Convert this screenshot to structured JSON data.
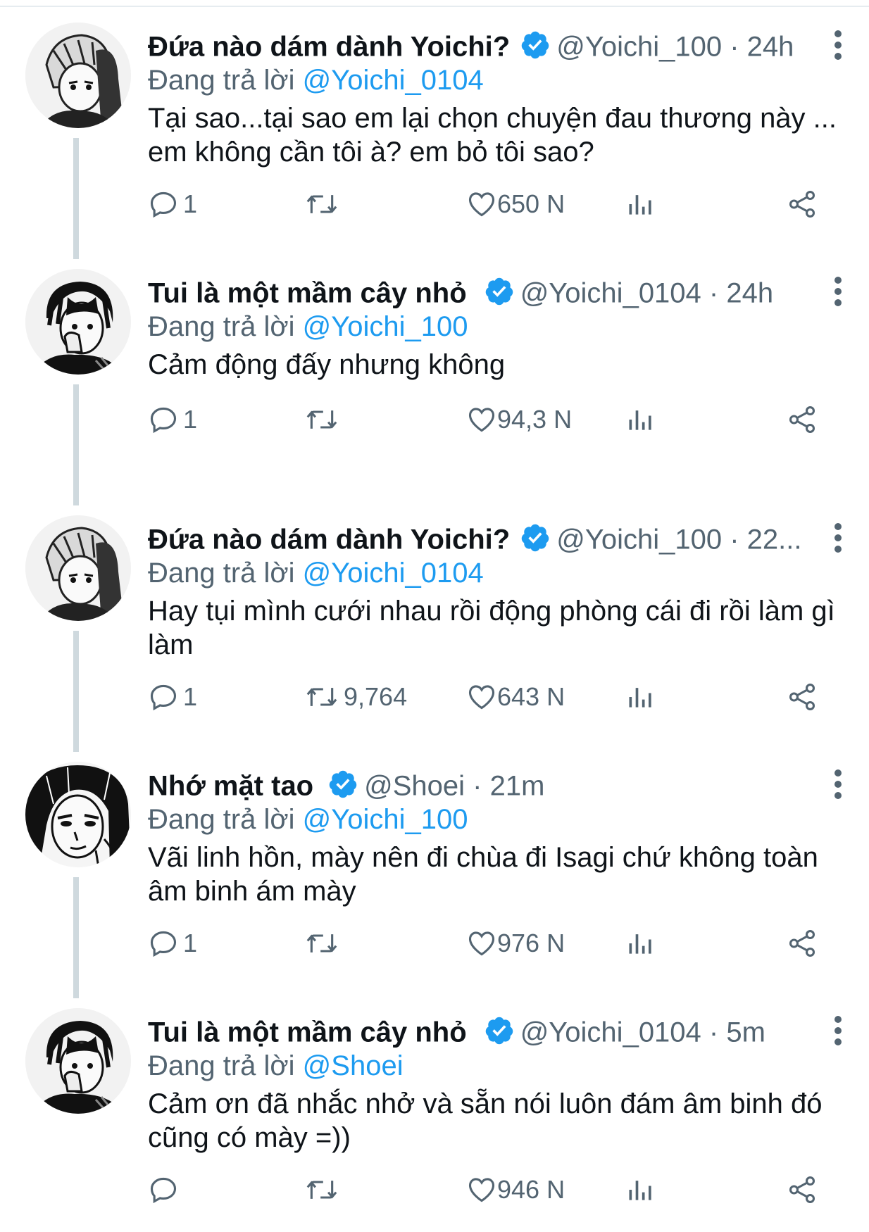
{
  "colors": {
    "link": "#1d9bf0",
    "secondary_text": "#536471",
    "primary_text": "#0f1419",
    "thread_line": "#cfd9de"
  },
  "icons": {
    "reply": "reply-icon",
    "retweet": "retweet-icon",
    "like": "heart-icon",
    "views": "views-icon",
    "share": "share-icon",
    "more": "more-vertical-icon",
    "verified": "verified-badge-icon"
  },
  "tweets": [
    {
      "display_name": "Đứa nào dám dành Yoichi?",
      "handle": "@Yoichi_100",
      "separator": "·",
      "time": "24h",
      "reply_prefix": "Đang trả lời",
      "reply_to": "@Yoichi_0104",
      "text": "Tại sao...tại sao em lại chọn chuyện đau thương này ... em không cần tôi à? em bỏ tôi sao?",
      "reply_count": "1",
      "retweet_count": "",
      "like_count": "650 N"
    },
    {
      "display_name": "Tui là một mầm cây nhỏ",
      "handle": "@Yoichi_0104",
      "separator": "·",
      "time": "24h",
      "reply_prefix": "Đang trả lời",
      "reply_to": "@Yoichi_100",
      "text": "Cảm động đấy nhưng không",
      "reply_count": "1",
      "retweet_count": "",
      "like_count": "94,3 N"
    },
    {
      "display_name": "Đứa nào dám dành Yoichi?",
      "handle": "@Yoichi_100",
      "separator": "·",
      "time": "22...",
      "reply_prefix": "Đang trả lời",
      "reply_to": "@Yoichi_0104",
      "text": "Hay tụi mình cưới nhau rồi động phòng cái đi rồi làm gì làm",
      "reply_count": "1",
      "retweet_count": "9,764",
      "like_count": "643 N"
    },
    {
      "display_name": "Nhớ mặt tao",
      "handle": "@Shoei",
      "separator": "·",
      "time": "21m",
      "reply_prefix": "Đang trả lời",
      "reply_to": "@Yoichi_100",
      "text": "Vãi linh hồn, mày nên đi chùa đi Isagi chứ không toàn âm binh ám mày",
      "reply_count": "1",
      "retweet_count": "",
      "like_count": "976 N"
    },
    {
      "display_name": "Tui là một mầm cây nhỏ",
      "handle": "@Yoichi_0104",
      "separator": "·",
      "time": "5m",
      "reply_prefix": "Đang trả lời",
      "reply_to": "@Shoei",
      "text": "Cảm ơn đã nhắc nhở và sẵn nói luôn đám âm binh đó cũng có mày =))",
      "reply_count": "",
      "retweet_count": "",
      "like_count": "946 N"
    }
  ]
}
